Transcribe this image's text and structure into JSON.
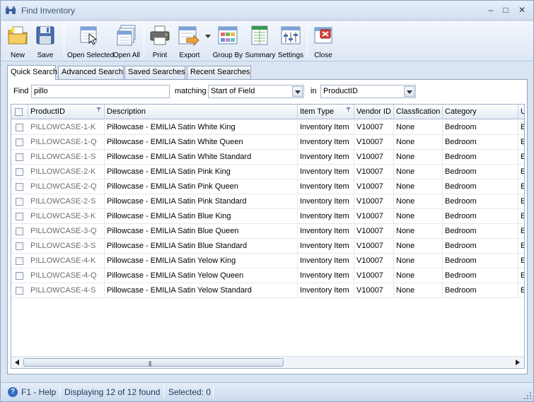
{
  "window": {
    "title": "Find Inventory",
    "controls": {
      "minimize": "–",
      "maximize": "□",
      "close": "✕"
    }
  },
  "toolbar": {
    "new_label": "New",
    "save_label": "Save",
    "open_selected_label": "Open Selected",
    "open_all_label": "Open All",
    "print_label": "Print",
    "export_label": "Export",
    "group_by_label": "Group By",
    "summary_label": "Summary",
    "settings_label": "Settings",
    "close_label": "Close"
  },
  "tabs": [
    {
      "label": "Quick Search",
      "active": true
    },
    {
      "label": "Advanced Search"
    },
    {
      "label": "Saved Searches"
    },
    {
      "label": "Recent Searches"
    }
  ],
  "search": {
    "find_label": "Find",
    "find_value": "pillo",
    "matching_label": "matching",
    "matching_value": "Start of Field",
    "in_label": "in",
    "in_value": "ProductID"
  },
  "grid": {
    "columns": [
      "ProductID",
      "Description",
      "Item Type",
      "Vendor ID",
      "Classfication",
      "Category",
      "U"
    ],
    "rows": [
      [
        "PILLOWCASE-1-K",
        "Pillowcase - EMILIA Satin White King",
        "Inventory Item",
        "V10007",
        "None",
        "Bedroom",
        "E"
      ],
      [
        "PILLOWCASE-1-Q",
        "Pillowcase - EMILIA Satin White Queen",
        "Inventory Item",
        "V10007",
        "None",
        "Bedroom",
        "E"
      ],
      [
        "PILLOWCASE-1-S",
        "Pillowcase - EMILIA Satin White Standard",
        "Inventory Item",
        "V10007",
        "None",
        "Bedroom",
        "E"
      ],
      [
        "PILLOWCASE-2-K",
        "Pillowcase - EMILIA Satin Pink King",
        "Inventory Item",
        "V10007",
        "None",
        "Bedroom",
        "E"
      ],
      [
        "PILLOWCASE-2-Q",
        "Pillowcase - EMILIA Satin Pink Queen",
        "Inventory Item",
        "V10007",
        "None",
        "Bedroom",
        "E"
      ],
      [
        "PILLOWCASE-2-S",
        "Pillowcase - EMILIA Satin Pink Standard",
        "Inventory Item",
        "V10007",
        "None",
        "Bedroom",
        "E"
      ],
      [
        "PILLOWCASE-3-K",
        "Pillowcase - EMILIA Satin Blue King",
        "Inventory Item",
        "V10007",
        "None",
        "Bedroom",
        "E"
      ],
      [
        "PILLOWCASE-3-Q",
        "Pillowcase - EMILIA Satin Blue Queen",
        "Inventory Item",
        "V10007",
        "None",
        "Bedroom",
        "E"
      ],
      [
        "PILLOWCASE-3-S",
        "Pillowcase - EMILIA Satin Blue Standard",
        "Inventory Item",
        "V10007",
        "None",
        "Bedroom",
        "E"
      ],
      [
        "PILLOWCASE-4-K",
        "Pillowcase - EMILIA Satin Yelow King",
        "Inventory Item",
        "V10007",
        "None",
        "Bedroom",
        "E"
      ],
      [
        "PILLOWCASE-4-Q",
        "Pillowcase - EMILIA Satin Yelow Queen",
        "Inventory Item",
        "V10007",
        "None",
        "Bedroom",
        "E"
      ],
      [
        "PILLOWCASE-4-S",
        "Pillowcase - EMILIA Satin Yelow Standard",
        "Inventory Item",
        "V10007",
        "None",
        "Bedroom",
        "E"
      ]
    ]
  },
  "statusbar": {
    "help": "F1 - Help",
    "displaying": "Displaying 12 of 12 found",
    "selected": "Selected: 0"
  },
  "colors": {
    "accent": "#2f6cc0",
    "chrome": "#dbe4f1",
    "border": "#8ea4c1"
  }
}
